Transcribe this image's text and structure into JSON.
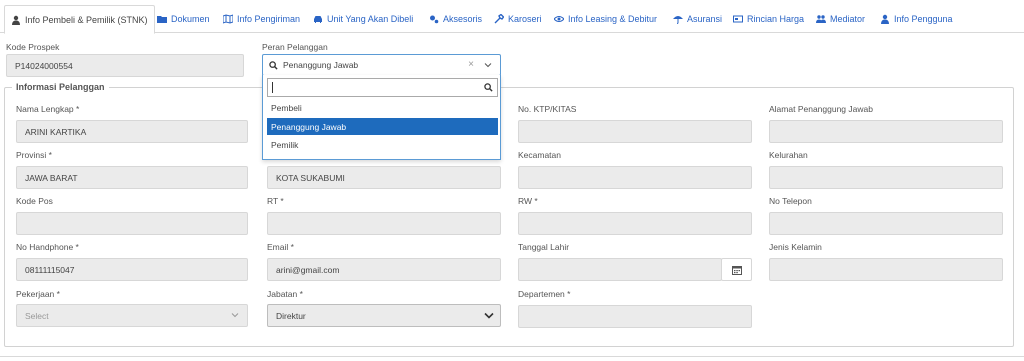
{
  "tabs": [
    {
      "label": "Info Pembeli & Pemilik (STNK)",
      "icon": "user-icon"
    },
    {
      "label": "Dokumen",
      "icon": "folder-icon"
    },
    {
      "label": "Info Pengiriman",
      "icon": "map-icon"
    },
    {
      "label": "Unit Yang Akan Dibeli",
      "icon": "car-icon"
    },
    {
      "label": "Aksesoris",
      "icon": "gears-icon"
    },
    {
      "label": "Karoseri",
      "icon": "wrench-icon"
    },
    {
      "label": "Info Leasing & Debitur",
      "icon": "eye-icon"
    },
    {
      "label": "Asuransi",
      "icon": "umbrella-icon"
    },
    {
      "label": "Rincian Harga",
      "icon": "card-icon"
    },
    {
      "label": "Mediator",
      "icon": "users-icon"
    },
    {
      "label": "Info Pengguna",
      "icon": "user-icon"
    }
  ],
  "kode_prospek": {
    "label": "Kode Prospek",
    "value": "P14024000554"
  },
  "peran": {
    "label": "Peran Pelanggan",
    "value": "Penanggung Jawab",
    "clear": "×",
    "search_value": "",
    "options": [
      "Pembeli",
      "Penanggung Jawab",
      "Pemilik"
    ]
  },
  "section_title": "Informasi Pelanggan",
  "fields": {
    "nama": {
      "label": "Nama Lengkap *",
      "value": "ARINI KARTIKA"
    },
    "ktp": {
      "label": "No. KTP/KITAS",
      "value": ""
    },
    "alamat": {
      "label": "Alamat Penanggung Jawab",
      "value": ""
    },
    "provinsi": {
      "label": "Provinsi *",
      "value": "JAWA BARAT"
    },
    "kota": {
      "label": "",
      "value": "KOTA SUKABUMI"
    },
    "kecamatan": {
      "label": "Kecamatan",
      "value": ""
    },
    "kelurahan": {
      "label": "Kelurahan",
      "value": ""
    },
    "kodepos": {
      "label": "Kode Pos",
      "value": ""
    },
    "rt": {
      "label": "RT *",
      "value": ""
    },
    "rw": {
      "label": "RW *",
      "value": ""
    },
    "telepon": {
      "label": "No Telepon",
      "value": ""
    },
    "handphone": {
      "label": "No Handphone *",
      "value": "08111115047"
    },
    "email": {
      "label": "Email *",
      "value": "arini@gmail.com"
    },
    "tgl_lahir": {
      "label": "Tanggal Lahir",
      "value": ""
    },
    "jenis_kelamin": {
      "label": "Jenis Kelamin",
      "value": ""
    },
    "pekerjaan": {
      "label": "Pekerjaan *",
      "value": "Select"
    },
    "jabatan": {
      "label": "Jabatan *",
      "value": "Direktur"
    },
    "departemen": {
      "label": "Departemen *",
      "value": ""
    }
  },
  "colors": {
    "accent": "#2a64c5",
    "selected": "#1e6bbd",
    "field_bg": "#ebebeb",
    "focus_border": "#5b9bd5"
  }
}
